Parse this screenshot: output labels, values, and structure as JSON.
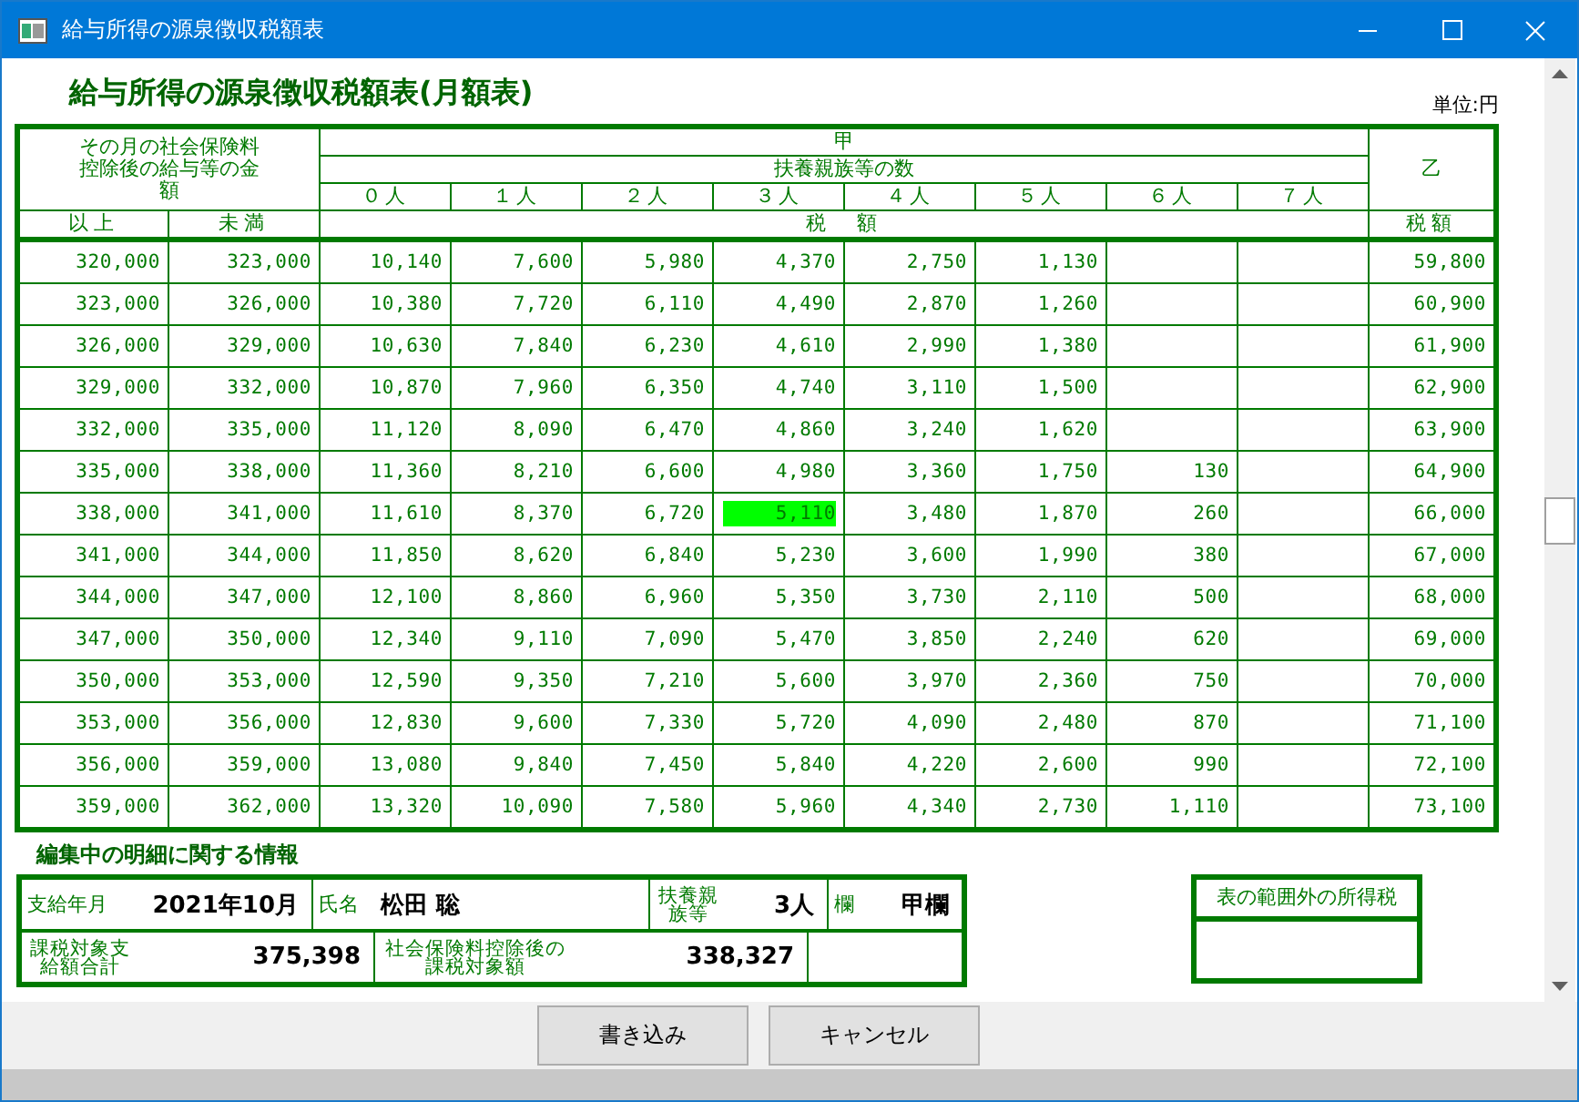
{
  "window": {
    "title": "給与所得の源泉徴収税額表"
  },
  "heading": "給与所得の源泉徴収税額表(月額表)",
  "unit": "単位:円",
  "table": {
    "left_header": "その月の社会保険料控除後の給与等の金額",
    "kou": "甲",
    "dependents_header": "扶養親族等の数",
    "otsu": "乙",
    "dependent_columns": [
      "０人",
      "１人",
      "２人",
      "３人",
      "４人",
      "５人",
      "６人",
      "７人"
    ],
    "from": "以上",
    "to": "未満",
    "tax": "税　額",
    "otsu_tax": "税額",
    "rows": [
      {
        "from": "320,000",
        "to": "323,000",
        "kou": [
          {
            "value": "10,140",
            "selected": false
          },
          {
            "value": "7,600",
            "selected": false
          },
          {
            "value": "5,980",
            "selected": false
          },
          {
            "value": "4,370",
            "selected": false
          },
          {
            "value": "2,750",
            "selected": false
          },
          {
            "value": "1,130",
            "selected": false
          }
        ],
        "otsu": "59,800"
      },
      {
        "from": "323,000",
        "to": "326,000",
        "kou": [
          {
            "value": "10,380",
            "selected": false
          },
          {
            "value": "7,720",
            "selected": false
          },
          {
            "value": "6,110",
            "selected": false
          },
          {
            "value": "4,490",
            "selected": false
          },
          {
            "value": "2,870",
            "selected": false
          },
          {
            "value": "1,260",
            "selected": false
          }
        ],
        "otsu": "60,900"
      },
      {
        "from": "326,000",
        "to": "329,000",
        "kou": [
          {
            "value": "10,630",
            "selected": false
          },
          {
            "value": "7,840",
            "selected": false
          },
          {
            "value": "6,230",
            "selected": false
          },
          {
            "value": "4,610",
            "selected": false
          },
          {
            "value": "2,990",
            "selected": false
          },
          {
            "value": "1,380",
            "selected": false
          }
        ],
        "otsu": "61,900"
      },
      {
        "from": "329,000",
        "to": "332,000",
        "kou": [
          {
            "value": "10,870",
            "selected": false
          },
          {
            "value": "7,960",
            "selected": false
          },
          {
            "value": "6,350",
            "selected": false
          },
          {
            "value": "4,740",
            "selected": false
          },
          {
            "value": "3,110",
            "selected": false
          },
          {
            "value": "1,500",
            "selected": false
          }
        ],
        "otsu": "62,900"
      },
      {
        "from": "332,000",
        "to": "335,000",
        "kou": [
          {
            "value": "11,120",
            "selected": false
          },
          {
            "value": "8,090",
            "selected": false
          },
          {
            "value": "6,470",
            "selected": false
          },
          {
            "value": "4,860",
            "selected": false
          },
          {
            "value": "3,240",
            "selected": false
          },
          {
            "value": "1,620",
            "selected": false
          }
        ],
        "otsu": "63,900"
      },
      {
        "from": "335,000",
        "to": "338,000",
        "kou": [
          {
            "value": "11,360",
            "selected": false
          },
          {
            "value": "8,210",
            "selected": false
          },
          {
            "value": "6,600",
            "selected": false
          },
          {
            "value": "4,980",
            "selected": false
          },
          {
            "value": "3,360",
            "selected": false
          },
          {
            "value": "1,750",
            "selected": false
          },
          {
            "value": "130",
            "selected": false
          }
        ],
        "otsu": "64,900"
      },
      {
        "from": "338,000",
        "to": "341,000",
        "kou": [
          {
            "value": "11,610",
            "selected": false
          },
          {
            "value": "8,370",
            "selected": false
          },
          {
            "value": "6,720",
            "selected": false
          },
          {
            "value": "5,110",
            "selected": true
          },
          {
            "value": "3,480",
            "selected": false
          },
          {
            "value": "1,870",
            "selected": false
          },
          {
            "value": "260",
            "selected": false
          }
        ],
        "otsu": "66,000"
      },
      {
        "from": "341,000",
        "to": "344,000",
        "kou": [
          {
            "value": "11,850",
            "selected": false
          },
          {
            "value": "8,620",
            "selected": false
          },
          {
            "value": "6,840",
            "selected": false
          },
          {
            "value": "5,230",
            "selected": false
          },
          {
            "value": "3,600",
            "selected": false
          },
          {
            "value": "1,990",
            "selected": false
          },
          {
            "value": "380",
            "selected": false
          }
        ],
        "otsu": "67,000"
      },
      {
        "from": "344,000",
        "to": "347,000",
        "kou": [
          {
            "value": "12,100",
            "selected": false
          },
          {
            "value": "8,860",
            "selected": false
          },
          {
            "value": "6,960",
            "selected": false
          },
          {
            "value": "5,350",
            "selected": false
          },
          {
            "value": "3,730",
            "selected": false
          },
          {
            "value": "2,110",
            "selected": false
          },
          {
            "value": "500",
            "selected": false
          }
        ],
        "otsu": "68,000"
      },
      {
        "from": "347,000",
        "to": "350,000",
        "kou": [
          {
            "value": "12,340",
            "selected": false
          },
          {
            "value": "9,110",
            "selected": false
          },
          {
            "value": "7,090",
            "selected": false
          },
          {
            "value": "5,470",
            "selected": false
          },
          {
            "value": "3,850",
            "selected": false
          },
          {
            "value": "2,240",
            "selected": false
          },
          {
            "value": "620",
            "selected": false
          }
        ],
        "otsu": "69,000"
      },
      {
        "from": "350,000",
        "to": "353,000",
        "kou": [
          {
            "value": "12,590",
            "selected": false
          },
          {
            "value": "9,350",
            "selected": false
          },
          {
            "value": "7,210",
            "selected": false
          },
          {
            "value": "5,600",
            "selected": false
          },
          {
            "value": "3,970",
            "selected": false
          },
          {
            "value": "2,360",
            "selected": false
          },
          {
            "value": "750",
            "selected": false
          }
        ],
        "otsu": "70,000"
      },
      {
        "from": "353,000",
        "to": "356,000",
        "kou": [
          {
            "value": "12,830",
            "selected": false
          },
          {
            "value": "9,600",
            "selected": false
          },
          {
            "value": "7,330",
            "selected": false
          },
          {
            "value": "5,720",
            "selected": false
          },
          {
            "value": "4,090",
            "selected": false
          },
          {
            "value": "2,480",
            "selected": false
          },
          {
            "value": "870",
            "selected": false
          }
        ],
        "otsu": "71,100"
      },
      {
        "from": "356,000",
        "to": "359,000",
        "kou": [
          {
            "value": "13,080",
            "selected": false
          },
          {
            "value": "9,840",
            "selected": false
          },
          {
            "value": "7,450",
            "selected": false
          },
          {
            "value": "5,840",
            "selected": false
          },
          {
            "value": "4,220",
            "selected": false
          },
          {
            "value": "2,600",
            "selected": false
          },
          {
            "value": "990",
            "selected": false
          }
        ],
        "otsu": "72,100"
      },
      {
        "from": "359,000",
        "to": "362,000",
        "kou": [
          {
            "value": "13,320",
            "selected": false
          },
          {
            "value": "10,090",
            "selected": false
          },
          {
            "value": "7,580",
            "selected": false
          },
          {
            "value": "5,960",
            "selected": false
          },
          {
            "value": "4,340",
            "selected": false
          },
          {
            "value": "2,730",
            "selected": false
          },
          {
            "value": "1,110",
            "selected": false
          }
        ],
        "otsu": "73,100"
      }
    ]
  },
  "info": {
    "title": "編集中の明細に関する情報",
    "pay_month_label": "支給年月",
    "pay_month": "2021年10月",
    "name_label": "氏名",
    "name": "松田 聡",
    "dependents_label": "扶養親族等",
    "dependents": "3人",
    "column_label": "欄",
    "column": "甲欄",
    "taxable_total_label": "課税対象支給額合計",
    "taxable_total": "375,398",
    "after_insurance_label": "社会保険料控除後の課税対象額",
    "after_insurance": "338,327"
  },
  "outside": {
    "title": "表の範囲外の所得税"
  },
  "buttons": [
    "書き込み",
    "キャンセル"
  ]
}
